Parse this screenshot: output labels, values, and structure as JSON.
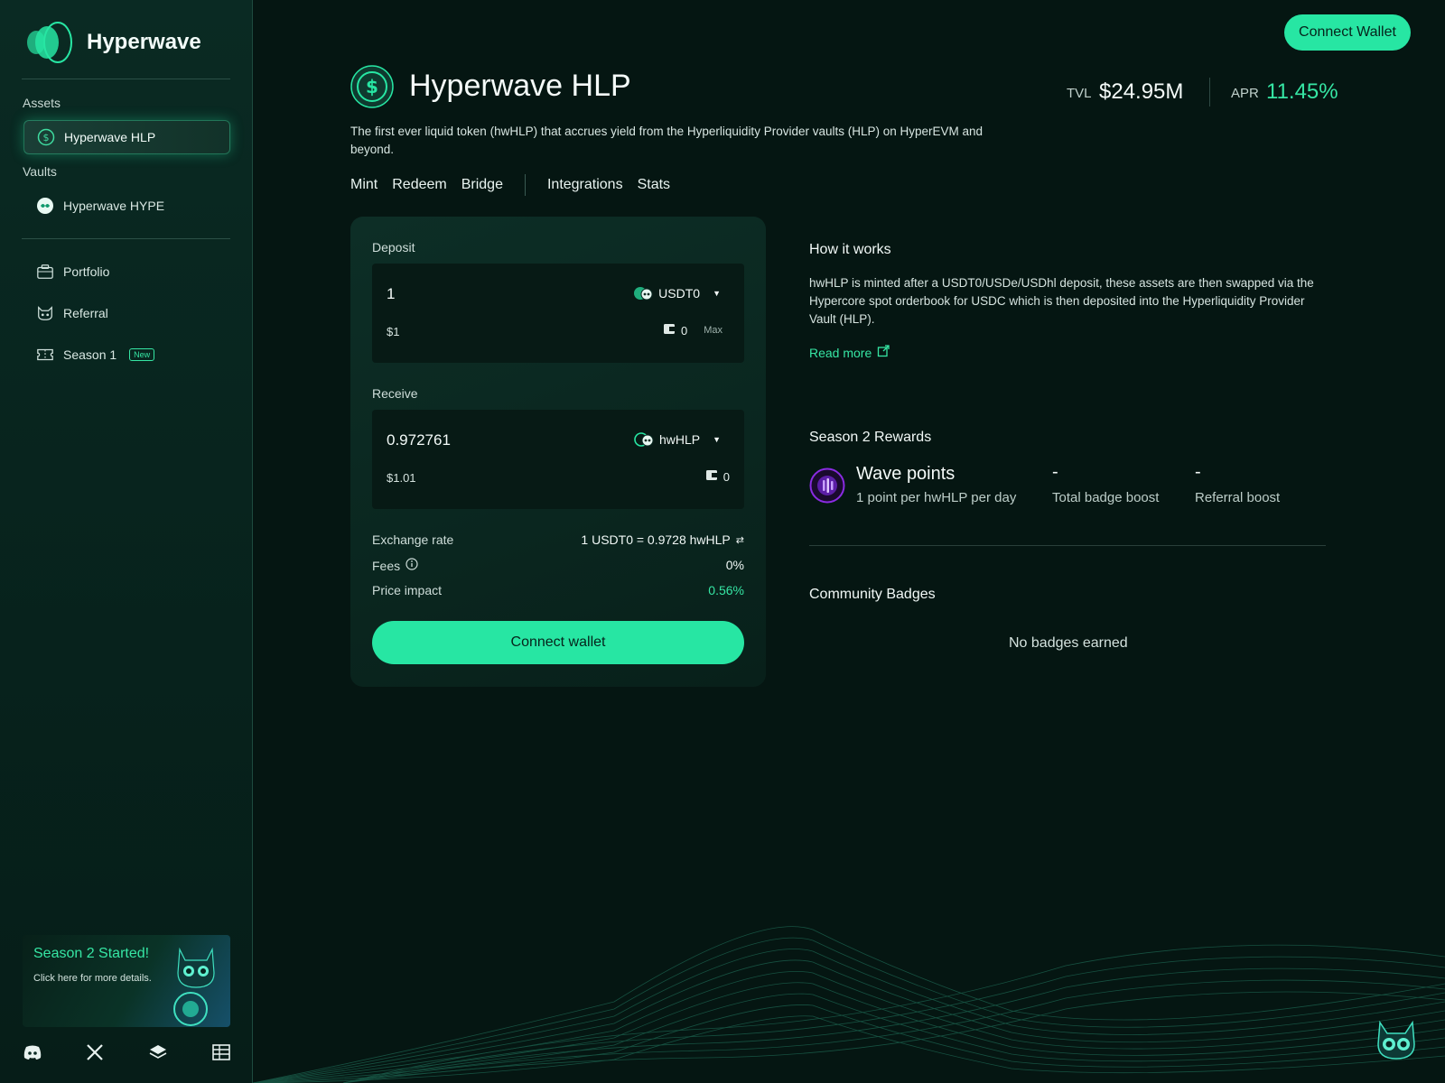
{
  "brand": {
    "name": "Hyperwave"
  },
  "sidebar": {
    "assets_label": "Assets",
    "vaults_label": "Vaults",
    "assets": [
      {
        "label": "Hyperwave HLP",
        "icon": "dollar-coin-icon"
      }
    ],
    "vaults": [
      {
        "label": "Hyperwave HYPE",
        "icon": "hype-token-icon"
      }
    ],
    "nav": [
      {
        "label": "Portfolio",
        "icon": "briefcase-icon"
      },
      {
        "label": "Referral",
        "icon": "cat-face-icon"
      },
      {
        "label": "Season 1",
        "icon": "ticket-icon",
        "badge": "New"
      }
    ],
    "promo": {
      "title": "Season 2 Started!",
      "subtitle": "Click here for more details."
    },
    "social": [
      "discord-icon",
      "x-icon",
      "stack-icon",
      "table-icon"
    ]
  },
  "header": {
    "connect_label": "Connect Wallet"
  },
  "page": {
    "title": "Hyperwave HLP",
    "description": "The first ever liquid token (hwHLP) that accrues yield from the Hyperliquidity Provider vaults (HLP) on HyperEVM and beyond.",
    "tvl_label": "TVL",
    "tvl_value": "$24.95M",
    "apr_label": "APR",
    "apr_value": "11.45%"
  },
  "tabs": {
    "primary": [
      "Mint",
      "Redeem",
      "Bridge"
    ],
    "secondary": [
      "Integrations",
      "Stats"
    ]
  },
  "swap": {
    "deposit_label": "Deposit",
    "deposit_amount": "1",
    "deposit_token": "USDT0",
    "deposit_usd": "$1",
    "deposit_balance": "0",
    "max_label": "Max",
    "receive_label": "Receive",
    "receive_amount": "0.972761",
    "receive_token": "hwHLP",
    "receive_usd": "$1.01",
    "receive_balance": "0",
    "exchange_rate_label": "Exchange rate",
    "exchange_rate_value": "1 USDT0 = 0.9728 hwHLP",
    "fees_label": "Fees",
    "fees_value": "0%",
    "price_impact_label": "Price impact",
    "price_impact_value": "0.56%",
    "connect_label": "Connect wallet"
  },
  "how": {
    "title": "How it works",
    "text": "hwHLP is minted after a USDT0/USDe/USDhl deposit, these assets are then swapped via the Hypercore spot orderbook for USDC which is then deposited into the Hyperliquidity Provider Vault (HLP).",
    "read_more": "Read more"
  },
  "rewards": {
    "title": "Season 2 Rewards",
    "points_title": "Wave points",
    "points_sub": "1 point per hwHLP per day",
    "badge_value": "-",
    "badge_label": "Total badge boost",
    "referral_value": "-",
    "referral_label": "Referral boost"
  },
  "community": {
    "title": "Community Badges",
    "empty": "No badges earned"
  },
  "colors": {
    "accent": "#27e6a3",
    "background": "#051612",
    "sidebar": "#0a2a23",
    "reward_purple": "#8a2be2"
  }
}
